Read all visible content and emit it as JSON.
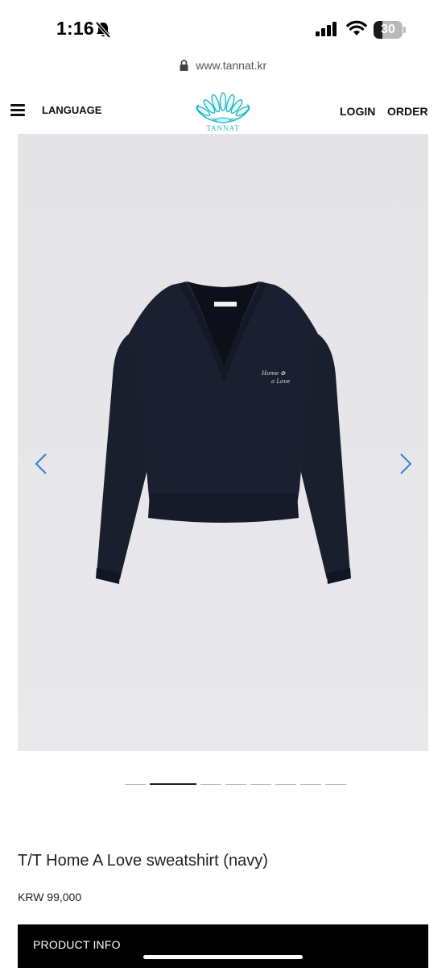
{
  "status_bar": {
    "time": "1:16",
    "battery_level": "30",
    "battery_fraction": 0.3,
    "icons": [
      "bell-slash-icon",
      "signal-icon",
      "wifi-icon",
      "battery-icon"
    ]
  },
  "browser": {
    "url": "www.tannat.kr",
    "lock_icon": "lock-icon"
  },
  "header": {
    "menu_icon": "hamburger-menu-icon",
    "language_label": "LANGUAGE",
    "logo_text": "TANNAT",
    "login_label": "LOGIN",
    "order_label": "ORDER",
    "brand_color": "#27b8c4"
  },
  "gallery": {
    "prev_icon": "chevron-left-icon",
    "next_icon": "chevron-right-icon",
    "arrow_color": "#2f7de1",
    "image_count": 8,
    "active_index": 1,
    "garment_color": "#1a1f2e",
    "background_color": "#e6e6e8"
  },
  "product": {
    "title": "T/T Home A Love sweatshirt (navy)",
    "price": "KRW 99,000",
    "info_label": "PRODUCT INFO"
  }
}
